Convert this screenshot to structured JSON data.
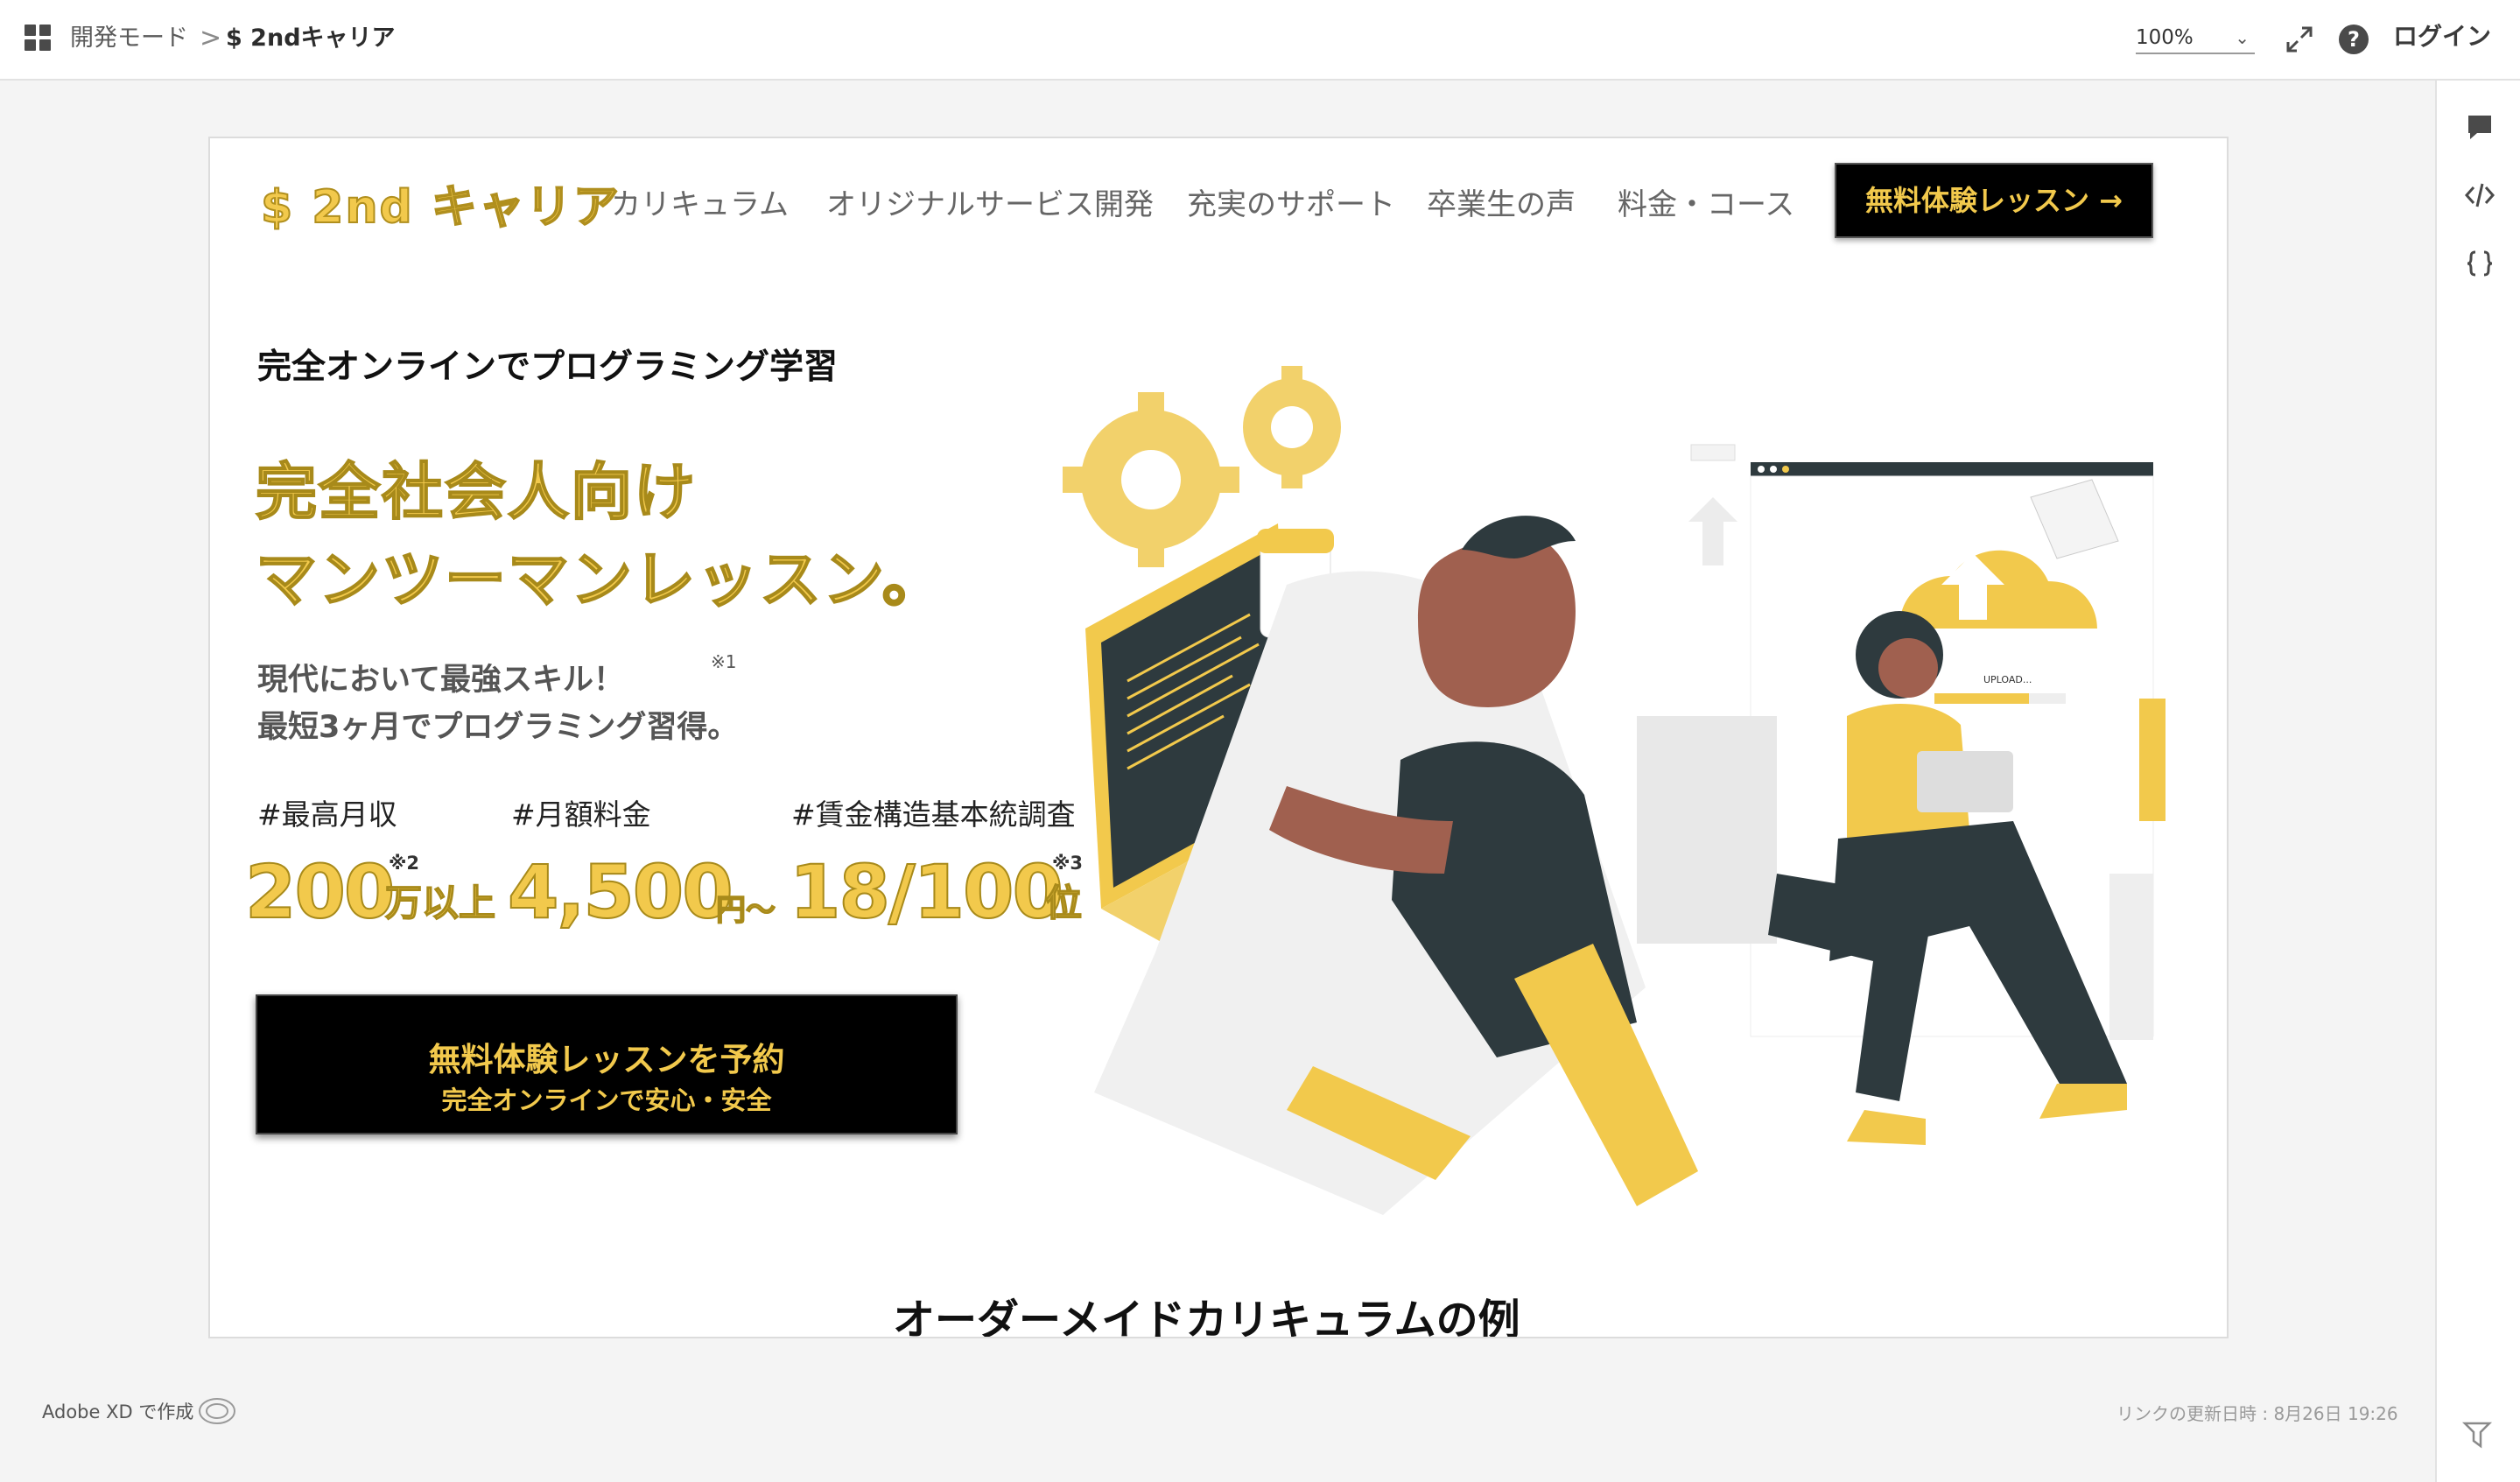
{
  "topbar": {
    "breadcrumb_mode": "開発モード",
    "breadcrumb_sep": ">",
    "breadcrumb_page": "$ 2ndキャリア",
    "zoom": "100%",
    "login": "ログイン"
  },
  "site": {
    "logo": "$ 2nd キャリア",
    "nav": [
      "カリキュラム",
      "オリジナルサービス開発",
      "充実のサポート",
      "卒業生の声",
      "料金・コース"
    ],
    "nav_cta": "無料体験レッスン →",
    "subhead": "完全オンラインでプログラミング学習",
    "hero_line1": "完全社会人向け",
    "hero_line2": "マンツーマンレッスン。",
    "desc_line1": "現代において最強スキル！",
    "desc_line2": "最短3ヶ月でプログラミング習得。",
    "desc_note": "※1",
    "stats": [
      {
        "label": "#最高月収",
        "value": "200",
        "unit": "万以上",
        "mark": "※2"
      },
      {
        "label": "#月額料金",
        "value": "4,500",
        "unit": "円〜",
        "mark": ""
      },
      {
        "label": "#賃金構造基本統調査",
        "value": "18/100",
        "unit": "位",
        "mark": "※3"
      }
    ],
    "cta_line1": "無料体験レッスンを予約",
    "cta_line2": "完全オンラインで安心・安全",
    "section_title": "オーダーメイドカリキュラムの例",
    "illustration_text": "UPLOAD..."
  },
  "footer": {
    "made_with": "Adobe XD で作成",
    "updated": "リンクの更新日時 : 8月26日 19:26"
  },
  "colors": {
    "accent": "#f2c94c",
    "dark": "#2e3a3e",
    "skin": "#a0604f"
  },
  "icons": [
    "grid-icon",
    "expand-icon",
    "help-icon",
    "comment-icon",
    "code-icon",
    "braces-icon",
    "cloud-icon",
    "flag-icon"
  ]
}
